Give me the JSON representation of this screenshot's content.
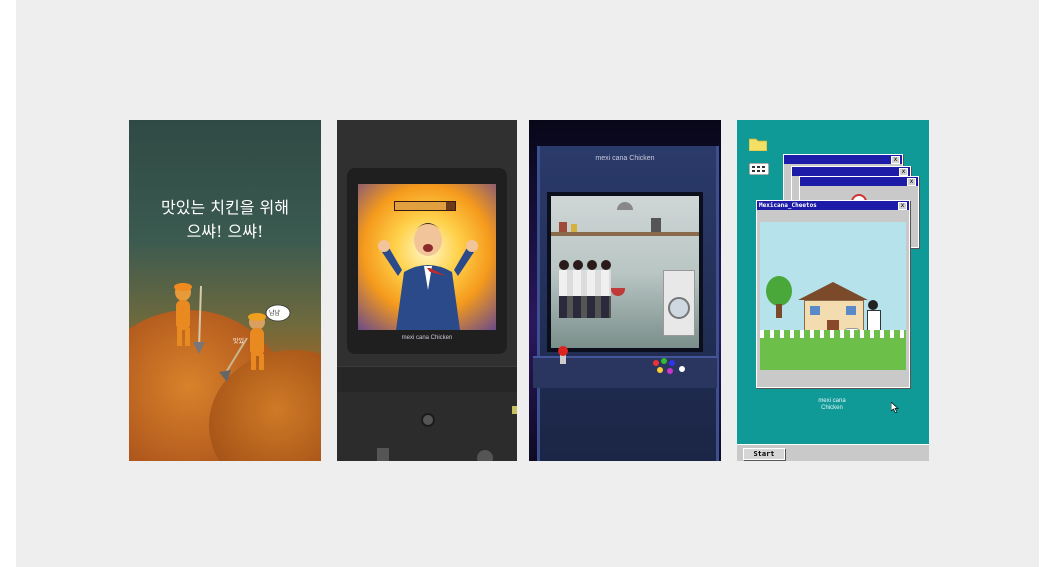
{
  "card1": {
    "headline_line1": "맛있는 치킨을 위해",
    "headline_line2": "으쌰! 으쌰!",
    "bubble_text": "냠냠",
    "small_label": "맛있"
  },
  "card2": {
    "logo_brand": "mexi cana",
    "logo_word": "Chicken"
  },
  "card3": {
    "logo_brand": "mexi cana",
    "logo_word": "Chicken"
  },
  "card4": {
    "window_title": "Mexicana_Cheetos",
    "close_glyph": "x",
    "logo_brand": "mexi cana",
    "logo_word": "Chicken",
    "start_label": "Start"
  },
  "colors": {
    "page_bg": "#eeeeee",
    "desktop_teal": "#0f9a98",
    "titlebar_blue": "#1c1ca8"
  }
}
